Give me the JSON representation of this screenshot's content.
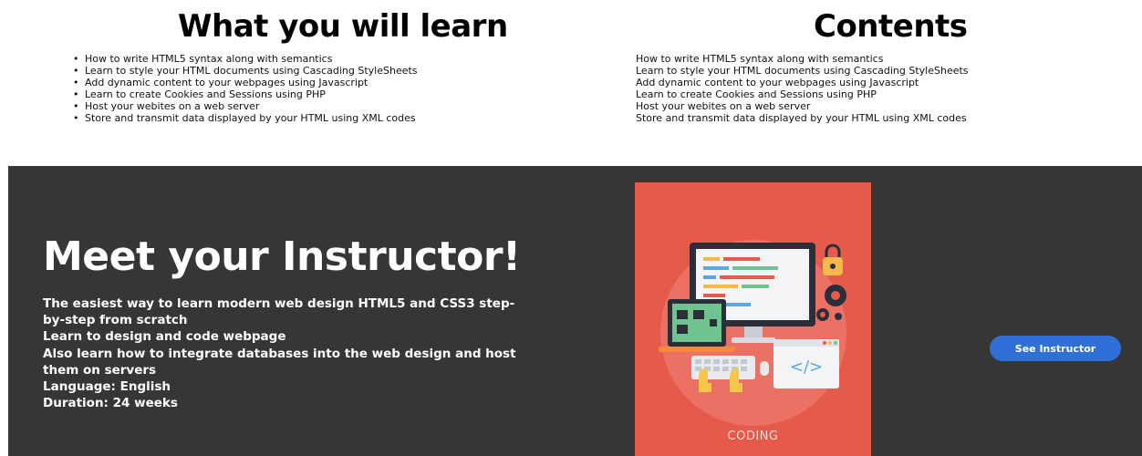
{
  "learn": {
    "title": "What you will learn",
    "items": [
      "How to write HTML5 syntax along with semantics",
      "Learn to style your HTML documents using Cascading StyleSheets",
      "Add dynamic content to your webpages using Javascript",
      "Learn to create Cookies and Sessions using PHP",
      "Host your webites on a web server",
      "Store and transmit data displayed by your HTML using XML codes"
    ]
  },
  "contents": {
    "title": "Contents",
    "items": [
      "How to write HTML5 syntax along with semantics",
      "Learn to style your HTML documents using Cascading StyleSheets",
      "Add dynamic content to your webpages using Javascript",
      "Learn to create Cookies and Sessions using PHP",
      "Host your webites on a web server",
      "Store and transmit data displayed by your HTML using XML codes"
    ]
  },
  "instructor": {
    "title": "Meet your Instructor!",
    "lines": [
      "The easiest way to learn modern web design HTML5 and CSS3 step-by-step from scratch",
      "Learn to design and code webpage",
      "Also learn how to integrate databases into the web design and host them on servers",
      "Language: English",
      "Duration: 24 weeks"
    ],
    "button_label": "See Instructor",
    "poster_caption": "CODING"
  },
  "colors": {
    "dark_bg": "#363636",
    "poster_bg": "#e65a4b",
    "button_bg": "#2f6fd8"
  }
}
